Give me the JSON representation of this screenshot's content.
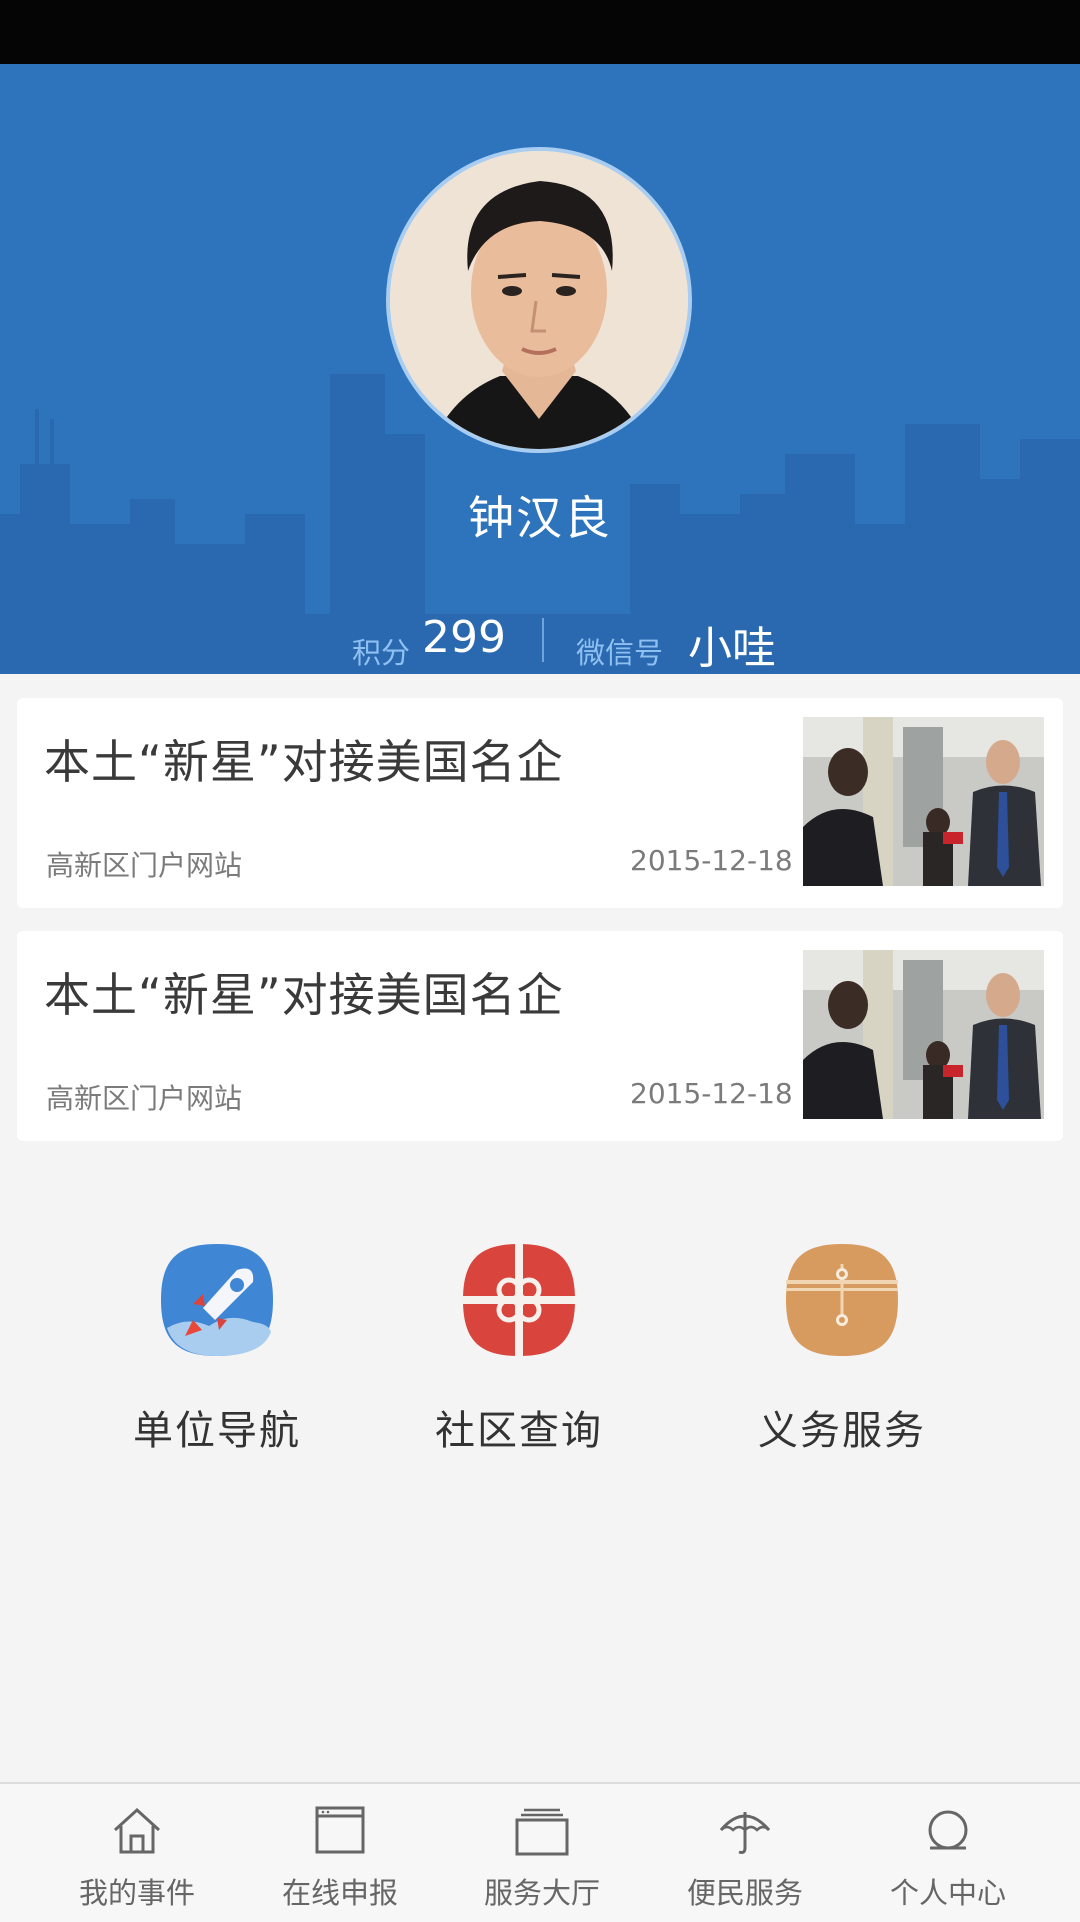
{
  "profile": {
    "name": "钟汉良",
    "points_label": "积分",
    "points_value": "299",
    "wechat_label": "微信号",
    "wechat_value": "小哇"
  },
  "news": [
    {
      "title": "本土“新星”对接美国名企",
      "source": "高新区门户网站",
      "date": "2015-12-18"
    },
    {
      "title": "本土“新星”对接美国名企",
      "source": "高新区门户网站",
      "date": "2015-12-18"
    }
  ],
  "features": [
    {
      "label": "单位导航",
      "icon": "rocket-icon"
    },
    {
      "label": "社区查询",
      "icon": "gift-icon"
    },
    {
      "label": "义务服务",
      "icon": "envelope-icon"
    }
  ],
  "nav": [
    {
      "label": "我的事件",
      "icon": "home-icon"
    },
    {
      "label": "在线申报",
      "icon": "window-icon"
    },
    {
      "label": "服务大厅",
      "icon": "folder-icon"
    },
    {
      "label": "便民服务",
      "icon": "umbrella-icon"
    },
    {
      "label": "个人中心",
      "icon": "person-icon"
    }
  ],
  "colors": {
    "header_blue": "#2e74bd",
    "skyline_blue": "#2a69b2",
    "rocket_bg": "#3f86d4",
    "gift_bg": "#d9453c",
    "envelope_bg": "#d89b5f"
  }
}
